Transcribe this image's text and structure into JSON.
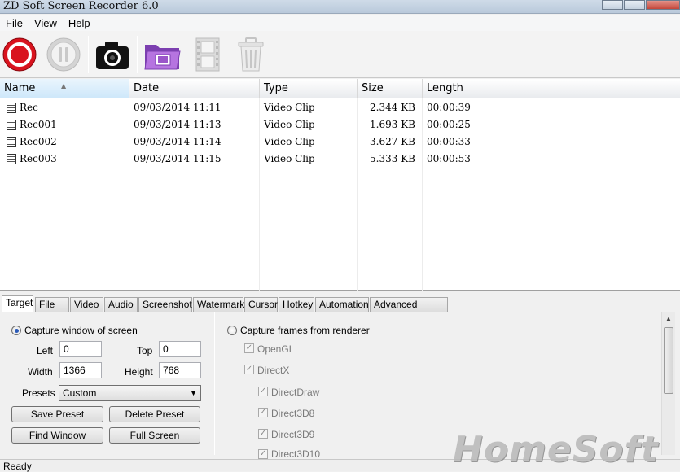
{
  "window": {
    "title": "ZD Soft Screen Recorder 6.0"
  },
  "menu": [
    "File",
    "View",
    "Help"
  ],
  "toolbar": {
    "items": [
      {
        "name": "record-icon"
      },
      {
        "name": "pause-icon"
      },
      {
        "name": "camera-icon"
      },
      {
        "name": "folder-video-icon"
      },
      {
        "name": "film-icon"
      },
      {
        "name": "trash-icon"
      }
    ],
    "colors": {
      "record": "#d9131e",
      "folder": "#9b55c9"
    }
  },
  "filelist": {
    "columns": [
      "Name",
      "Date",
      "Type",
      "Size",
      "Length"
    ],
    "rows": [
      {
        "name": "Rec",
        "date": "09/03/2014 11:11",
        "type": "Video Clip",
        "size": "2.344 KB",
        "length": "00:00:39"
      },
      {
        "name": "Rec001",
        "date": "09/03/2014 11:13",
        "type": "Video Clip",
        "size": "1.693 KB",
        "length": "00:00:25"
      },
      {
        "name": "Rec002",
        "date": "09/03/2014 11:14",
        "type": "Video Clip",
        "size": "3.627 KB",
        "length": "00:00:33"
      },
      {
        "name": "Rec003",
        "date": "09/03/2014 11:15",
        "type": "Video Clip",
        "size": "5.333 KB",
        "length": "00:00:53"
      }
    ]
  },
  "tabs": [
    "Target",
    "File",
    "Video",
    "Audio",
    "Screenshot",
    "Watermark",
    "Cursor",
    "Hotkey",
    "Automation",
    "Advanced Options"
  ],
  "target": {
    "capture_window_label": "Capture window of screen",
    "left_label": "Left",
    "left_value": "0",
    "top_label": "Top",
    "top_value": "0",
    "width_label": "Width",
    "width_value": "1366",
    "height_label": "Height",
    "height_value": "768",
    "presets_label": "Presets",
    "presets_value": "Custom",
    "save_preset": "Save Preset",
    "delete_preset": "Delete Preset",
    "find_window": "Find Window",
    "full_screen": "Full Screen",
    "capture_frames_label": "Capture frames from renderer",
    "opengl": "OpenGL",
    "directx": "DirectX",
    "directdraw": "DirectDraw",
    "direct3d8": "Direct3D8",
    "direct3d9": "Direct3D9",
    "direct3d10": "Direct3D10"
  },
  "status": {
    "text": "Ready"
  },
  "watermark": {
    "text": "HomeSoft"
  }
}
